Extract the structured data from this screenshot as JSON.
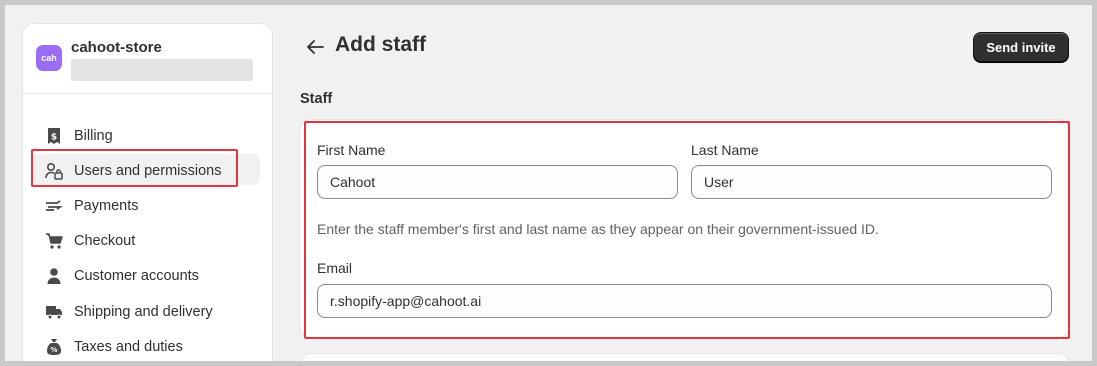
{
  "store": {
    "avatar_text": "cah",
    "name": "cahoot-store"
  },
  "sidebar": {
    "items": [
      {
        "label": "Billing",
        "icon": "receipt-dollar-icon"
      },
      {
        "label": "Users and permissions",
        "icon": "users-lock-icon",
        "active": true
      },
      {
        "label": "Payments",
        "icon": "payments-icon"
      },
      {
        "label": "Checkout",
        "icon": "cart-icon"
      },
      {
        "label": "Customer accounts",
        "icon": "person-icon"
      },
      {
        "label": "Shipping and delivery",
        "icon": "truck-icon"
      },
      {
        "label": "Taxes and duties",
        "icon": "tax-bag-icon"
      }
    ]
  },
  "header": {
    "title": "Add staff",
    "send_invite_label": "Send invite"
  },
  "staff_section": {
    "heading": "Staff",
    "first_name_label": "First Name",
    "first_name_value": "Cahoot",
    "last_name_label": "Last Name",
    "last_name_value": "User",
    "help_text": "Enter the staff member's first and last name as they appear on their government-issued ID.",
    "email_label": "Email",
    "email_value": "r.shopify-app@cahoot.ai"
  },
  "colors": {
    "highlight": "#e0383e",
    "avatar": "#9b6df5",
    "primary_button": "#303030"
  }
}
